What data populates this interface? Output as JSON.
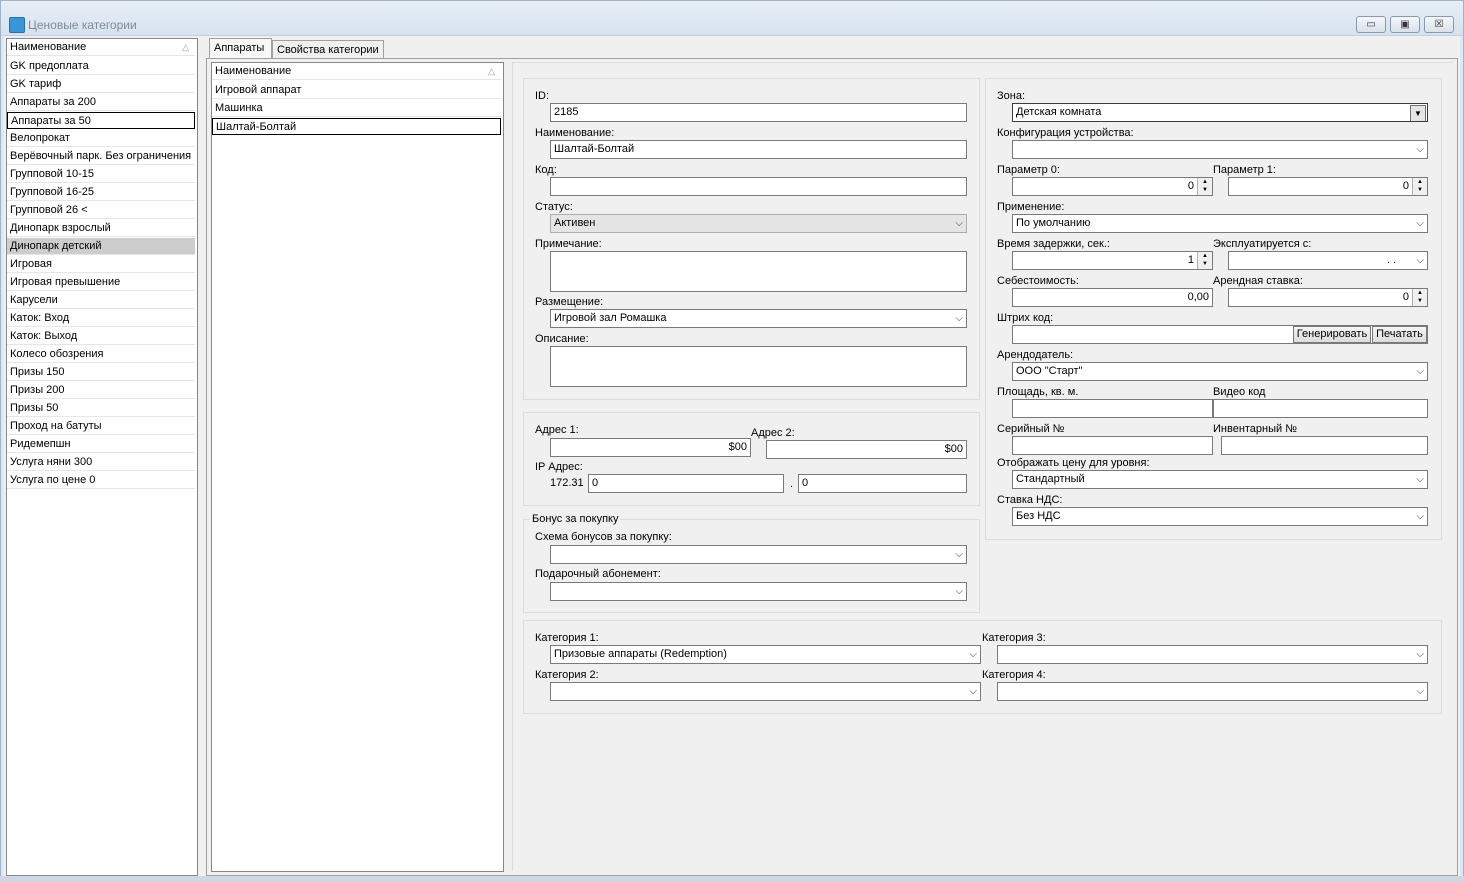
{
  "window": {
    "title": "Ценовые категории"
  },
  "categories": {
    "header": "Наименование",
    "items": [
      "GK  предоплата",
      "GK тариф",
      "Аппараты за 200",
      "Аппараты за 50",
      "Велопрокат",
      "Верёвочный парк. Без ограничения",
      "Групповой 10-15",
      "Групповой 16-25",
      "Групповой 26 <",
      "Динопарк взрослый",
      "Динопарк детский",
      "Игровая",
      "Игровая превышение",
      "Карусели",
      "Каток: Вход",
      "Каток: Выход",
      "Колесо обозрения",
      "Призы 150",
      "Призы 200",
      "Призы 50",
      "Проход на батуты",
      "Ридемепшн",
      "Услуга няни 300",
      "Услуга по цене 0"
    ]
  },
  "tabs": {
    "tab1": "Аппараты",
    "tab2": "Свойства категории"
  },
  "devices": {
    "header": "Наименование",
    "items": [
      "Игровой аппарат",
      "Машинка",
      "Шалтай-Болтай"
    ]
  },
  "form": {
    "id_label": "ID:",
    "id_value": "2185",
    "name_label": "Наименование:",
    "name_value": "Шалтай-Болтай",
    "code_label": "Код:",
    "code_value": "",
    "status_label": "Статус:",
    "status_value": "Активен",
    "note_label": "Примечание:",
    "placement_label": "Размещение:",
    "placement_value": "Игровой зал Ромашка",
    "description_label": "Описание:",
    "addr1_label": "Адрес 1:",
    "addr1_value": "$00",
    "addr2_label": "Адрес 2:",
    "addr2_value": "$00",
    "ip_label": "IP Адрес:",
    "ip_prefix": "172.31",
    "ip_part1": "0",
    "ip_dot": ".",
    "ip_part2": "0",
    "bonus_group": "Бонус за покупку",
    "bonus_scheme_label": "Схема бонусов за покупку:",
    "gift_label": "Подарочный абонемент:",
    "zone_label": "Зона:",
    "zone_value": "Детская комната",
    "config_label": "Конфигурация устройства:",
    "param0_label": "Параметр 0:",
    "param0_value": "0",
    "param1_label": "Параметр 1:",
    "param1_value": "0",
    "apply_label": "Применение:",
    "apply_value": "По умолчанию",
    "delay_label": "Время задержки, сек.:",
    "delay_value": "1",
    "exploit_label": "Эксплуатируется с:",
    "exploit_value": ". .",
    "cost_label": "Себестоимость:",
    "cost_value": "0,00",
    "rent_label": "Арендная ставка:",
    "rent_value": "0",
    "barcode_label": "Штрих код:",
    "generate_btn": "Генерировать",
    "print_btn": "Печатать",
    "landlord_label": "Арендодатель:",
    "landlord_value": "ООО \"Старт\"",
    "area_label": "Площадь, кв. м.",
    "video_label": "Видео код",
    "serial_label": "Серийный №",
    "inventory_label": "Инвентарный №",
    "price_level_label": "Отображать цену для уровня:",
    "price_level_value": "Стандартный",
    "vat_label": "Ставка НДС:",
    "vat_value": "Без НДС",
    "cat1_label": "Категория 1:",
    "cat1_value": "Призовые аппараты (Redemption)",
    "cat2_label": "Категория 2:",
    "cat3_label": "Категория 3:",
    "cat4_label": "Категория 4:"
  },
  "icons": {
    "sort": "△",
    "dropdown": "⌵",
    "spin_up": "▲",
    "spin_down": "▼",
    "minimize": "▭",
    "maximize": "▣",
    "close": "☒"
  }
}
